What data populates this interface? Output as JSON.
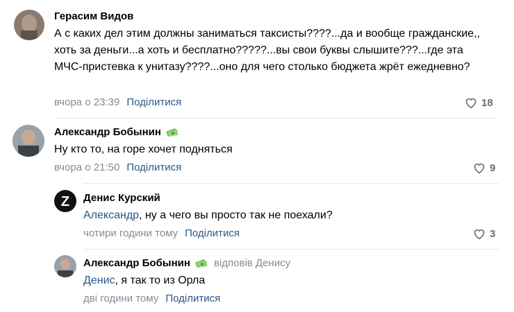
{
  "comments": [
    {
      "author": "Герасим Видов",
      "text": "А с каких дел этим должны заниматься таксисты????...да и вообще гражданские,, хоть за деньги...а хоть и бесплатно?????...вы свои буквы слышите???...где эта МЧС-пристевка к унитазу????...оно для чего столько бюджета жрёт ежедневно?",
      "time": "вчора о 23:39",
      "share": "Поділитися",
      "likes": "18"
    },
    {
      "author": "Александр Бобынин",
      "text": "Ну кто то, на горе хочет подняться",
      "time": "вчора о 21:50",
      "share": "Поділитися",
      "likes": "9",
      "badge_icon": "money-icon"
    }
  ],
  "replies": [
    {
      "author": "Денис Курский",
      "mention": "Александр",
      "text": ", ну а чего вы просто так не поехали?",
      "time": "чотири години тому",
      "share": "Поділитися",
      "likes": "3",
      "avatar_letter": "Z"
    },
    {
      "author": "Александр Бобынин",
      "replied_to": "відповів Денису",
      "mention": "Денис",
      "text": ", я так то из Орла",
      "time": "дві години тому",
      "share": "Поділитися",
      "badge_icon": "money-icon"
    }
  ],
  "colors": {
    "link": "#2a5885",
    "meta": "#818c99",
    "divider": "#e7e8ec"
  }
}
